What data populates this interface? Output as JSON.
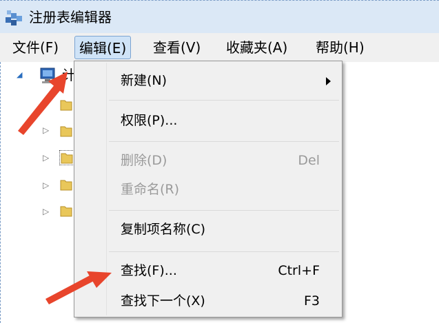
{
  "window": {
    "title": "注册表编辑器"
  },
  "menubar": [
    {
      "label": "文件(F)"
    },
    {
      "label": "编辑(E)",
      "active": true
    },
    {
      "label": "查看(V)"
    },
    {
      "label": "收藏夹(A)"
    },
    {
      "label": "帮助(H)"
    }
  ],
  "tree": {
    "root_label": "计"
  },
  "edit_menu": {
    "new": {
      "label": "新建(N)"
    },
    "permissions": {
      "label": "权限(P)..."
    },
    "delete": {
      "label": "删除(D)",
      "shortcut": "Del",
      "disabled": true
    },
    "rename": {
      "label": "重命名(R)",
      "disabled": true
    },
    "copy_key_name": {
      "label": "复制项名称(C)"
    },
    "find": {
      "label": "查找(F)...",
      "shortcut": "Ctrl+F"
    },
    "find_next": {
      "label": "查找下一个(X)",
      "shortcut": "F3"
    }
  },
  "colors": {
    "annotation_arrow": "#e8452c",
    "menu_highlight": "#cfe3f7",
    "disabled_text": "#9a9a9a"
  }
}
